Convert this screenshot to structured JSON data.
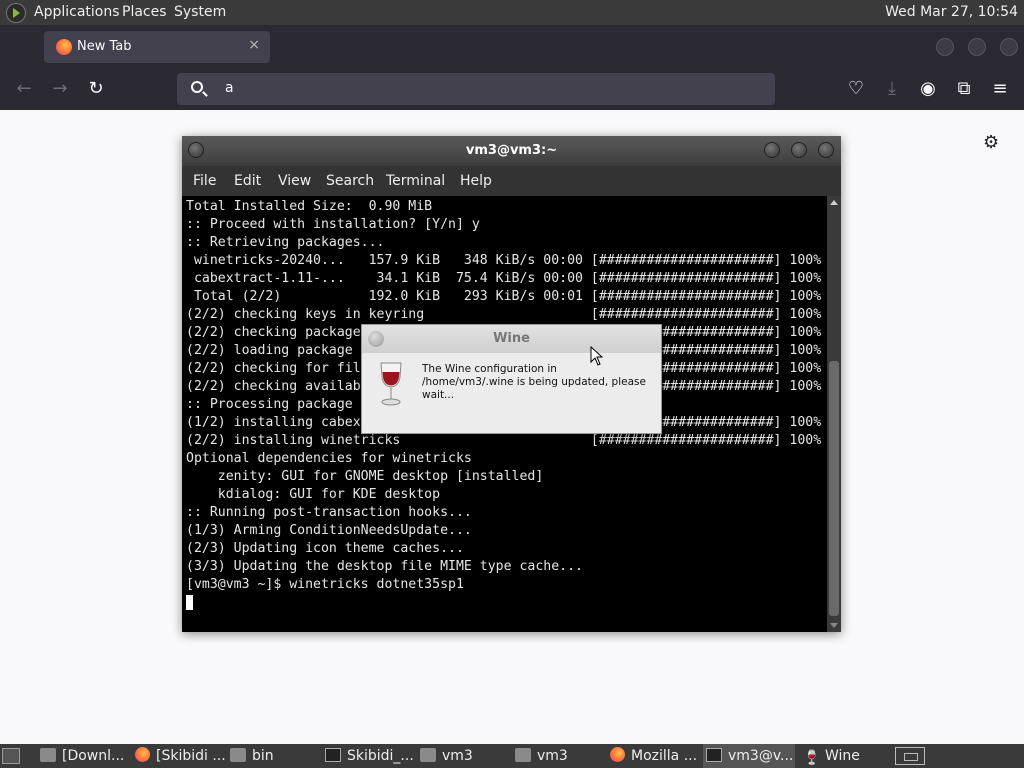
{
  "top_panel": {
    "menus": [
      "Applications",
      "Places",
      "System"
    ],
    "clock": "Wed Mar 27, 10:54"
  },
  "browser": {
    "tab": {
      "title": "New Tab",
      "close": "×"
    },
    "nav": {
      "back": "←",
      "forward": "→",
      "reload": "↻"
    },
    "urlbar": {
      "value": "a"
    },
    "toolbar": {
      "pocket": "♡",
      "download": "⤓",
      "account": "◉",
      "extensions": "⧉",
      "menu": "≡"
    },
    "settings_gear": "⚙"
  },
  "terminal": {
    "title": "vm3@vm3:~",
    "menu": [
      "File",
      "Edit",
      "View",
      "Search",
      "Terminal",
      "Help"
    ],
    "lines": [
      "Total Installed Size:  0.90 MiB",
      "",
      ":: Proceed with installation? [Y/n] y",
      ":: Retrieving packages...",
      " winetricks-20240...   157.9 KiB   348 KiB/s 00:00 [######################] 100%",
      " cabextract-1.11-...    34.1 KiB  75.4 KiB/s 00:00 [######################] 100%",
      " Total (2/2)           192.0 KiB   293 KiB/s 00:01 [######################] 100%",
      "(2/2) checking keys in keyring                     [######################] 100%",
      "(2/2) checking package integrity                   [######################] 100%",
      "(2/2) loading package files                        [######################] 100%",
      "(2/2) checking for file conflicts                  [######################] 100%",
      "(2/2) checking available disk space                [######################] 100%",
      ":: Processing package changes...",
      "(1/2) installing cabextract                        [######################] 100%",
      "(2/2) installing winetricks                        [######################] 100%",
      "Optional dependencies for winetricks",
      "    zenity: GUI for GNOME desktop [installed]",
      "    kdialog: GUI for KDE desktop",
      ":: Running post-transaction hooks...",
      "(1/3) Arming ConditionNeedsUpdate...",
      "(2/3) Updating icon theme caches...",
      "(3/3) Updating the desktop file MIME type cache...",
      "[vm3@vm3 ~]$ winetricks dotnet35sp1"
    ]
  },
  "wine_dialog": {
    "title": "Wine",
    "message": "The Wine configuration in /home/vm3/.wine is being updated, please wait..."
  },
  "taskbar": {
    "items": [
      {
        "label": "[Downl...",
        "icon": "folder-icon"
      },
      {
        "label": "[Skibidi ...",
        "icon": "firefox-icon"
      },
      {
        "label": "bin",
        "icon": "folder-icon"
      },
      {
        "label": "Skibidi_...",
        "icon": "terminal-icon"
      },
      {
        "label": "vm3",
        "icon": "folder-icon"
      },
      {
        "label": "vm3",
        "icon": "folder-icon"
      },
      {
        "label": "Mozilla ...",
        "icon": "firefox-icon"
      },
      {
        "label": "vm3@v...",
        "icon": "terminal-icon"
      },
      {
        "label": "Wine",
        "icon": "wine-icon"
      }
    ]
  }
}
